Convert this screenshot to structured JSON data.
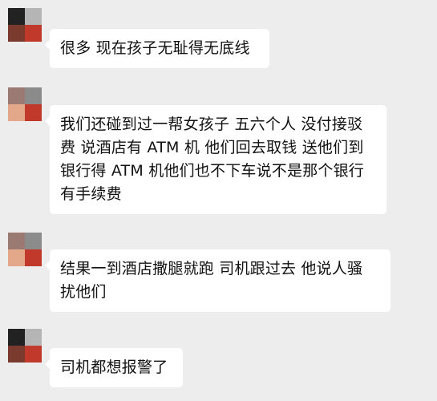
{
  "colors": {
    "background": "#ededed",
    "bubble": "#ffffff",
    "text": "#111111"
  },
  "messages": [
    {
      "sender_avatar": [
        "#222222",
        "#b5b5b5",
        "#7b3a2e",
        "#c0392b"
      ],
      "lines": [
        "很多 现在孩子无耻得无底线"
      ]
    },
    {
      "sender_avatar": [
        "#9a7a72",
        "#8b8b8b",
        "#e3a88a",
        "#c0392b"
      ],
      "lines": [
        "我们还碰到过一帮女孩子 五六个人 没付接驳",
        "费 说酒店有 ATM 机 他们回去取钱 送他们到",
        "银行得 ATM 机他们也不下车说不是那个银行",
        "有手续费"
      ]
    },
    {
      "sender_avatar": [
        "#9a7a72",
        "#8b8b8b",
        "#e3a88a",
        "#c0392b"
      ],
      "lines": [
        "结果一到酒店撒腿就跑  司机跟过去 他说人骚",
        "扰他们"
      ]
    },
    {
      "sender_avatar": [
        "#222222",
        "#b5b5b5",
        "#7b3a2e",
        "#c0392b"
      ],
      "lines": [
        "司机都想报警了"
      ]
    }
  ]
}
